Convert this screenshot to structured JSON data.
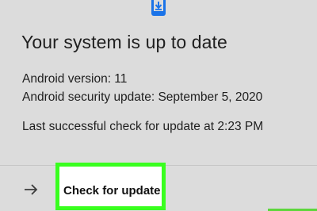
{
  "header": {
    "icon": "system-update-icon",
    "title": "Your system is up to date"
  },
  "details": {
    "android_version": "Android version: 11",
    "security_update": "Android security update: September 5, 2020",
    "last_check": "Last successful check for update at 2:23 PM"
  },
  "action": {
    "icon": "arrow-right-icon",
    "label": "Check for update"
  },
  "colors": {
    "background": "#dcdcdc",
    "accent_blue": "#1a73e8",
    "highlight_green": "#39ff1f"
  }
}
